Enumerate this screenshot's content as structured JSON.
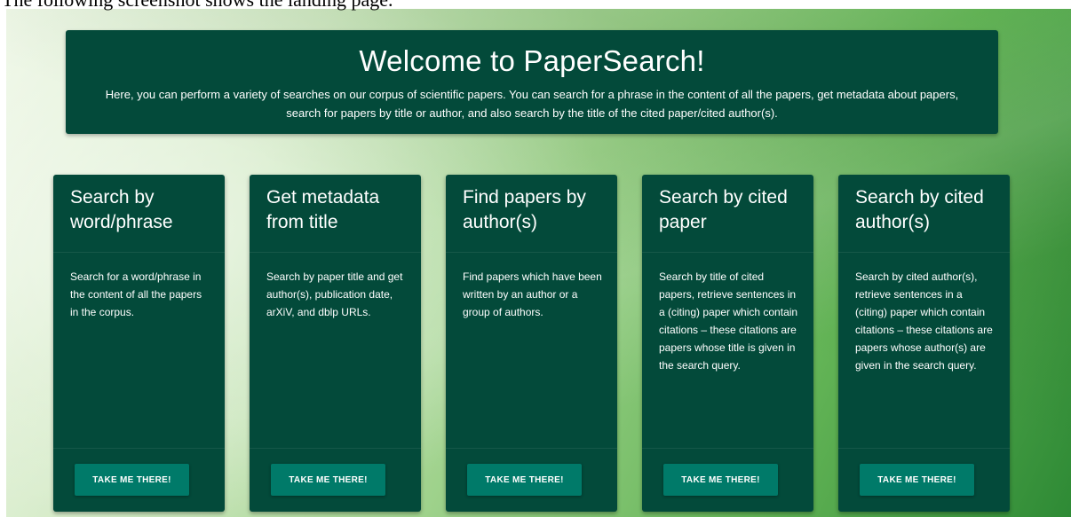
{
  "caption": "The following screenshot shows the landing page.",
  "welcome": {
    "title": "Welcome to PaperSearch!",
    "text": "Here, you can perform a variety of searches on our corpus of scientific papers. You can search for a phrase in the content of all the papers, get metadata about papers, search for papers by title or author, and also search by the title of the cited paper/cited author(s)."
  },
  "cards": [
    {
      "title": "Search by word/phrase",
      "description": "Search for a word/phrase in the content of all the papers in the corpus.",
      "button": "TAKE ME THERE!"
    },
    {
      "title": "Get metadata from title",
      "description": "Search by paper title and get author(s), publication date, arXiV, and dblp URLs.",
      "button": "TAKE ME THERE!"
    },
    {
      "title": "Find papers by author(s)",
      "description": "Find papers which have been written by an author or a group of authors.",
      "button": "TAKE ME THERE!"
    },
    {
      "title": "Search by cited paper",
      "description": "Search by title of cited papers, retrieve sentences in a (citing) paper which contain citations – these citations are papers whose title is given in the search query.",
      "button": "TAKE ME THERE!"
    },
    {
      "title": "Search by cited author(s)",
      "description": "Search by cited author(s), retrieve sentences in a (citing) paper which contain citations – these citations are papers whose author(s) are given in the search query.",
      "button": "TAKE ME THERE!"
    }
  ],
  "colors": {
    "panel": "#034a3a",
    "button": "#007a69",
    "text": "#ffffff"
  }
}
